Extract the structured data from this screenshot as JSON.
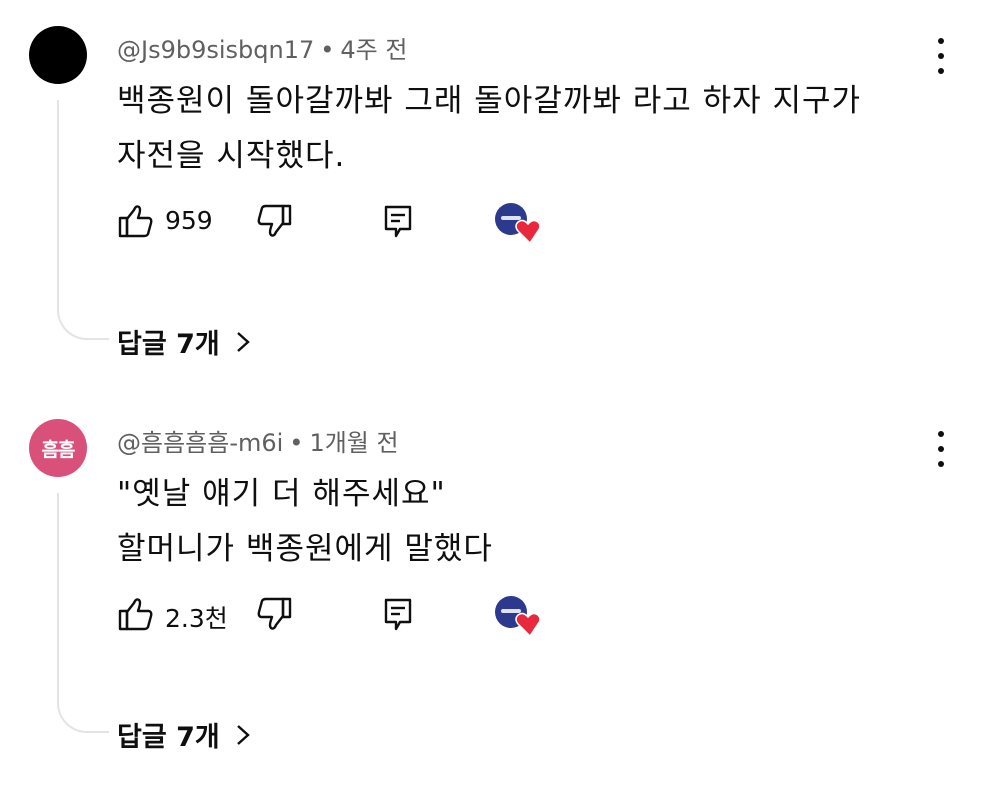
{
  "comments": [
    {
      "author": "@Js9b9sisbqn17",
      "separator": "•",
      "time": "4주 전",
      "avatar_text": "",
      "lines": [
        "백종원이 돌아갈까봐 그래 돌아갈까봐 라고 하자 지구가",
        "자전을 시작했다."
      ],
      "like_count": "959",
      "replies_label": "답글 7개"
    },
    {
      "author": "@흠흠흠흠-m6i",
      "separator": "•",
      "time": "1개월 전",
      "avatar_text": "흠흠",
      "lines": [
        "\"옛날 얘기 더 해주세요\"",
        "할머니가 백종원에게 말했다"
      ],
      "like_count": "2.3천",
      "replies_label": "답글 7개"
    }
  ],
  "icons": {
    "like": "thumbs-up-icon",
    "dislike": "thumbs-down-icon",
    "reply": "comment-icon",
    "more": "more-vertical-icon",
    "creator_heart": "creator-heart-icon",
    "chevron": "chevron-right-icon"
  },
  "colors": {
    "avatar_pink": "#d9517a",
    "creator_avatar": "#2b3a8c",
    "heart": "#e8283c",
    "meta_text": "#606060"
  }
}
